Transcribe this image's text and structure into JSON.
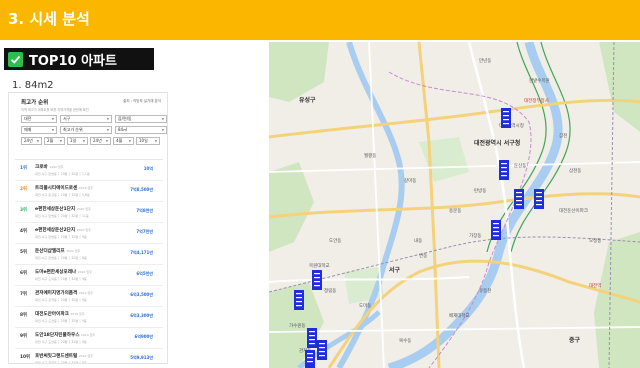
{
  "header": {
    "title": "3. 시세 분석",
    "accent_color": "#fbb600"
  },
  "badge": {
    "icon": "check-icon",
    "label": "TOP10 아파트",
    "check_color": "#2ebd4e"
  },
  "subheading": "1. 84m2",
  "panel": {
    "title": "최고가 순위",
    "top_right": "출처 : 직방부 실거래 분석",
    "description": "지역 최고가 아파트를 보를 지역가격을 한번에 확인",
    "filters_row1": [
      "대전",
      "서구",
      "읍/면/동"
    ],
    "filters_row2": [
      "매매",
      "최고가 순위",
      "84㎡"
    ],
    "filters_row3": [
      "24년",
      "2월",
      "1일",
      "24년",
      "4월",
      "10일"
    ],
    "rows": [
      {
        "rank": "1위",
        "name": "크로바",
        "year": "1992 입주",
        "info": "대전 서구 탄방동 │ 20평 │ 32평 │ 1,1층",
        "price": "10억",
        "rank_color": "#2f6fd0"
      },
      {
        "rank": "2위",
        "name": "트리플시티에이드로센",
        "year": "2016 입주",
        "info": "대전 서구 둔산동 │ 20평 │ 32평 │ 5,6층",
        "price": "7억8,500만",
        "rank_color": "#e67e22"
      },
      {
        "rank": "3위",
        "name": "e편한세상둔산1단지",
        "year": "2020 입주",
        "info": "대전 서구 탄방동 │ 20평 │ 32평 │ 11층",
        "price": "7억8천만",
        "rank_color": "#27ae60"
      },
      {
        "rank": "4위",
        "name": "e편한세상둔산2단지",
        "year": "2020 입주",
        "info": "대전 서구 탄방동 │ 20평 │ 32평 │ 9층",
        "price": "7억7천만",
        "rank_color": "#333333"
      },
      {
        "rank": "5위",
        "name": "둔산더샵엘리프",
        "year": "2022 입주",
        "info": "대전 서구 탄방동 │ 20평 │ 32평 │ 8층",
        "price": "7억4,171만",
        "rank_color": "#333333"
      },
      {
        "rank": "6위",
        "name": "도마e편한세상포레나",
        "year": "2022 입주",
        "info": "대전 서구 도마동 │ 20평 │ 32평 │ 9층",
        "price": "6억5천만",
        "rank_color": "#333333"
      },
      {
        "rank": "7위",
        "name": "관저예미지명가의품격",
        "year": "2019 입주",
        "info": "대전 서구 관저동 │ 20평 │ 32평 │ 9층",
        "price": "6억3,500만",
        "rank_color": "#333333"
      },
      {
        "rank": "8위",
        "name": "대전도안아이파크",
        "year": "2018 입주",
        "info": "대전 서구 도안동 │ 20평 │ 32평 │ 9층",
        "price": "6억3,300만",
        "rank_color": "#333333"
      },
      {
        "rank": "9위",
        "name": "도안18단지린풀하우스",
        "year": "2014 입주",
        "info": "대전 서구 도안동 │ 20평 │ 32평 │ 9층",
        "price": "6억900만",
        "rank_color": "#333333"
      },
      {
        "rank": "10위",
        "name": "호반써밋그랜드센트럴",
        "year": "2022 입주",
        "info": "대전 서구 용문동 │ 20평 │ 32평 │ 9층",
        "price": "5억9,913만",
        "rank_color": "#333333"
      }
    ]
  },
  "map": {
    "labels": [
      "대전광역시 서구청",
      "대전광역시청",
      "대전둔산이파크",
      "둔산동",
      "탄방동",
      "용문동",
      "갈마동",
      "월평동",
      "도안동",
      "가수원동",
      "관저동",
      "도마동",
      "정림동",
      "복수동",
      "유성구",
      "서구",
      "중구",
      "대전정부청사",
      "한밭수목원",
      "유등천",
      "갑천",
      "목원대학교",
      "배재대학교",
      "대전역",
      "내동",
      "변동",
      "가장동",
      "만년동",
      "삼천동",
      "오정동"
    ],
    "building_icon": "apartment-building-icon",
    "marker_color": "#1f2fd6"
  }
}
